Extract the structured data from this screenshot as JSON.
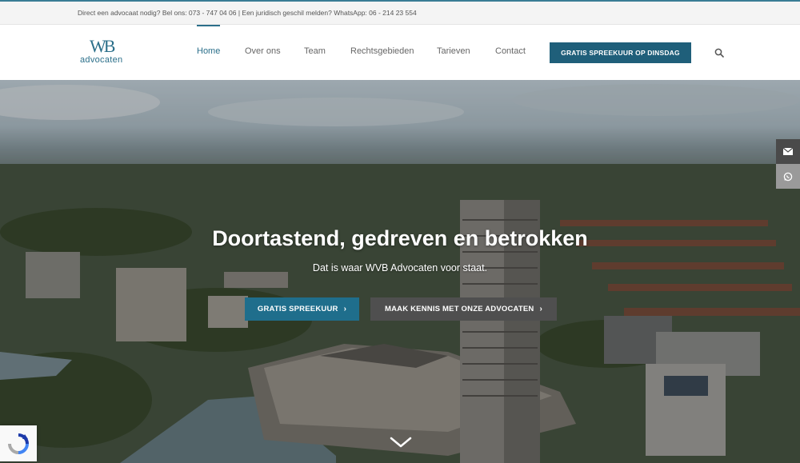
{
  "topbar": {
    "text": "Direct een advocaat nodig? Bel ons: 073 - 747 04 06 | Een juridisch geschil melden? WhatsApp: 06 - 214 23 554"
  },
  "logo": {
    "mark": "WB",
    "text": "advocaten"
  },
  "nav": {
    "items": [
      {
        "label": "Home",
        "active": true
      },
      {
        "label": "Over ons"
      },
      {
        "label": "Team"
      },
      {
        "label": "Rechtsgebieden"
      },
      {
        "label": "Tarieven"
      },
      {
        "label": "Contact"
      }
    ],
    "cta_label": "GRATIS SPREEKUUR OP DINSDAG"
  },
  "hero": {
    "title": "Doortastend, gedreven en betrokken",
    "subtitle": "Dat is waar WVB Advocaten voor staat.",
    "primary_button": "GRATIS SPREEKUUR",
    "secondary_button": "MAAK KENNIS MET ONZE ADVOCATEN"
  },
  "icons": {
    "search": "search-icon",
    "mail": "mail-icon",
    "whatsapp": "whatsapp-icon",
    "scroll": "chevron-down-icon",
    "recaptcha": "recaptcha-icon"
  },
  "colors": {
    "brand": "#2b6f8a",
    "cta": "#1f5f7a",
    "secondary_button": "#4f4f4f"
  }
}
